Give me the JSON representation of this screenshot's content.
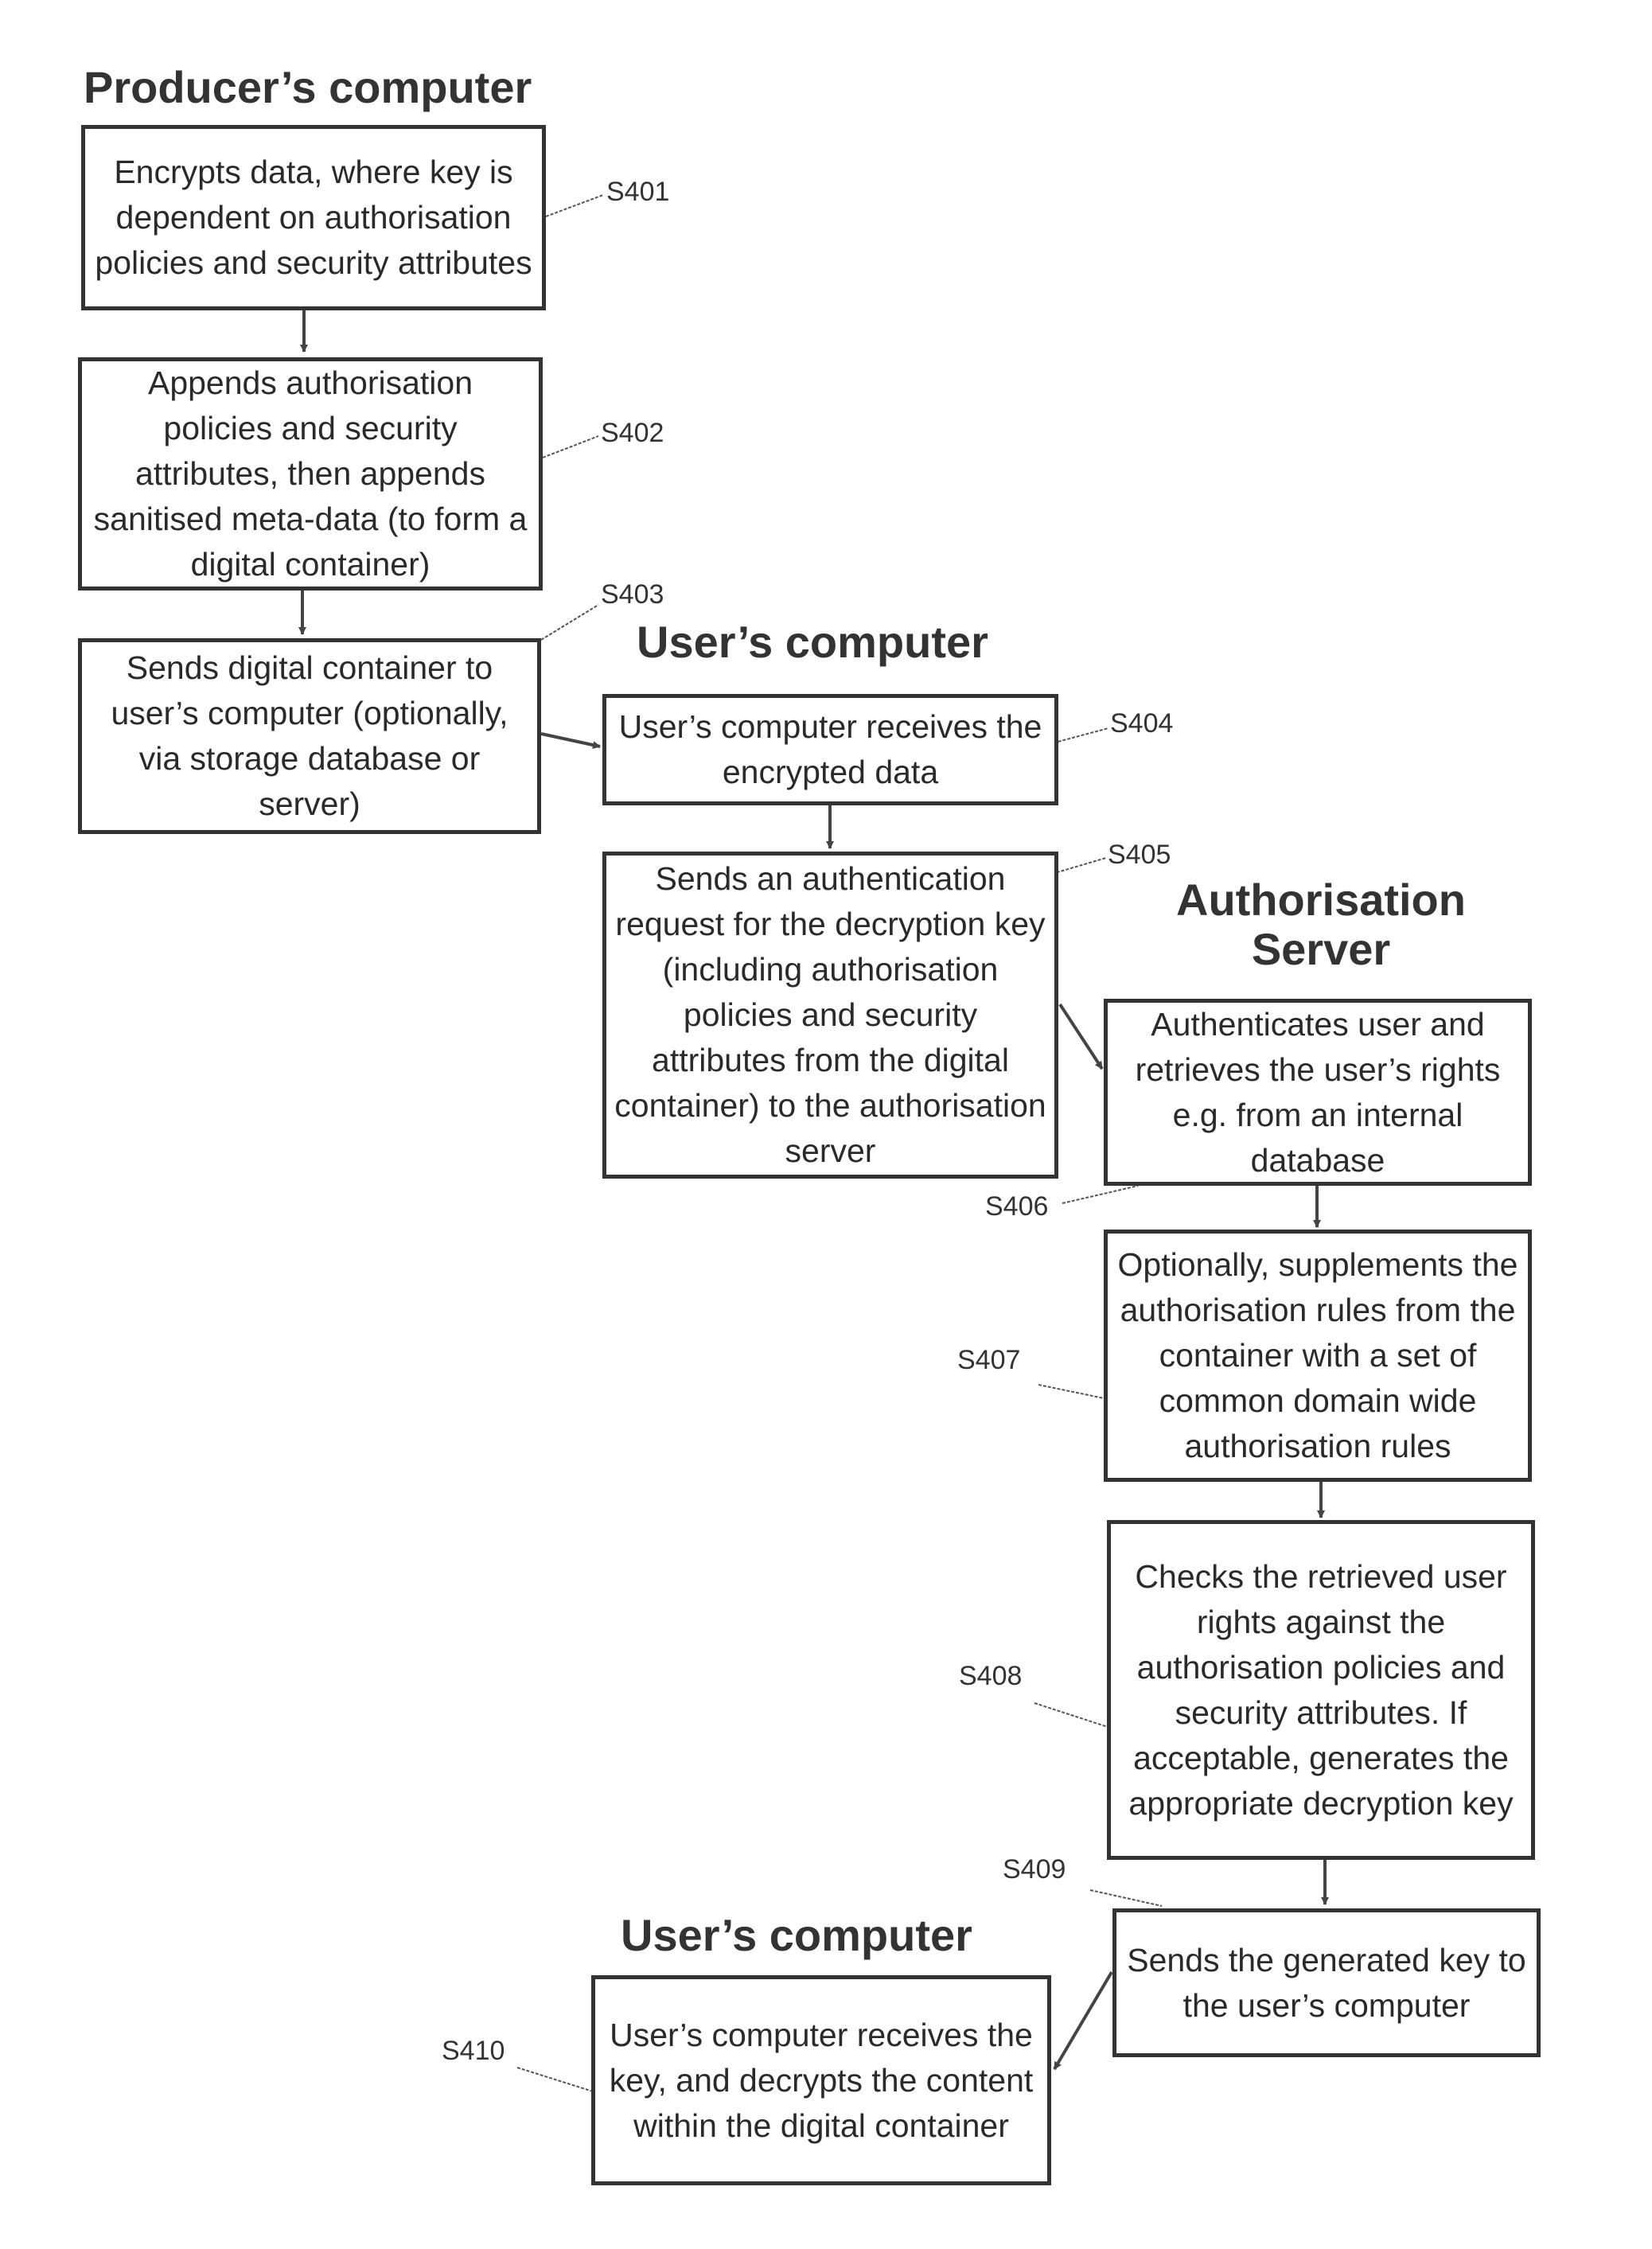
{
  "diagram": {
    "titles": {
      "producer": "Producer’s computer",
      "user_top": "User’s computer",
      "auth_server": "Authorisation Server",
      "user_bottom": "User’s computer"
    },
    "steps": [
      {
        "id": "S401",
        "text": "Encrypts data, where key is dependent on authorisation policies and security attributes"
      },
      {
        "id": "S402",
        "text": "Appends authorisation policies and security attributes, then appends sanitised meta-data (to form a digital container)"
      },
      {
        "id": "S403",
        "text": "Sends digital container to user’s computer (optionally, via storage database or server)"
      },
      {
        "id": "S404",
        "text": "User’s computer receives the encrypted data"
      },
      {
        "id": "S405",
        "text": "Sends an authentication request for the decryption key (including authorisation policies and security attributes from the digital container) to the authorisation server"
      },
      {
        "id": "S406",
        "text": "Authenticates user and retrieves the user’s rights e.g. from an internal database"
      },
      {
        "id": "S407",
        "text": "Optionally, supplements the authorisation rules from the container with a set of common domain wide authorisation rules"
      },
      {
        "id": "S408",
        "text": "Checks the retrieved user rights against the authorisation policies and security attributes. If acceptable, generates the appropriate decryption key"
      },
      {
        "id": "S409",
        "text": "Sends the generated key to the user’s computer"
      },
      {
        "id": "S410",
        "text": "User’s computer receives the key, and decrypts the content within the digital container"
      }
    ],
    "flow": [
      [
        "S401",
        "S402"
      ],
      [
        "S402",
        "S403"
      ],
      [
        "S403",
        "S404"
      ],
      [
        "S404",
        "S405"
      ],
      [
        "S405",
        "S406"
      ],
      [
        "S406",
        "S407"
      ],
      [
        "S407",
        "S408"
      ],
      [
        "S408",
        "S409"
      ],
      [
        "S409",
        "S410"
      ]
    ]
  }
}
